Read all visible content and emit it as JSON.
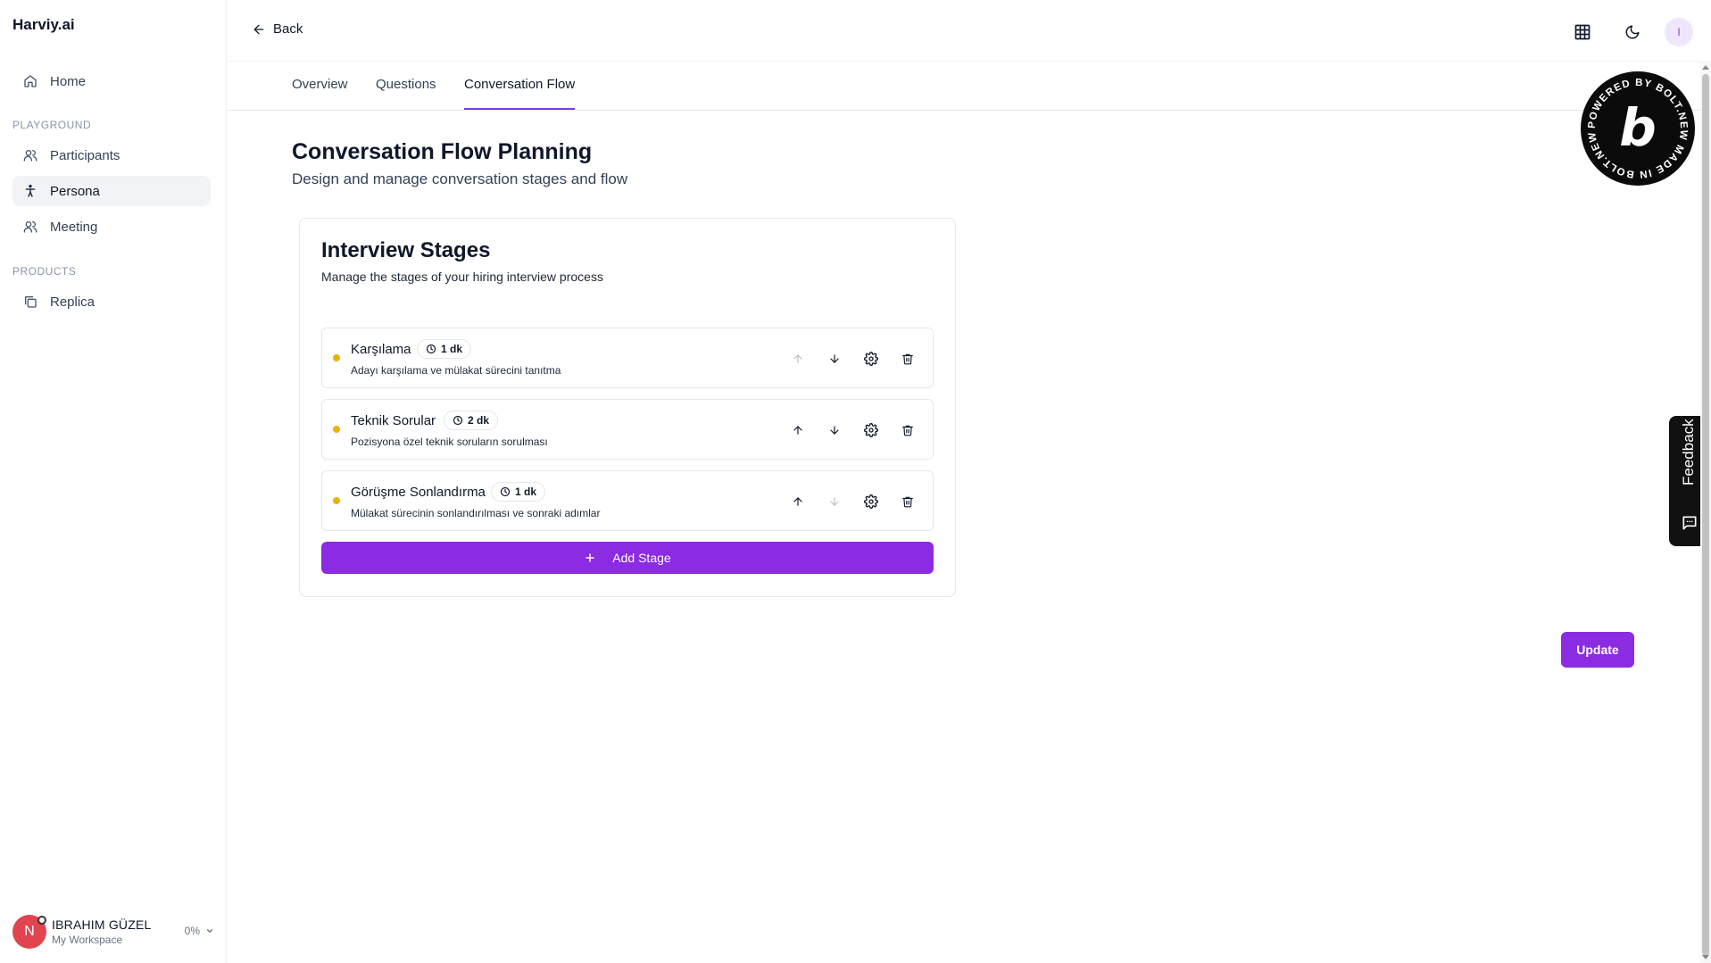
{
  "brand": "Harviy.ai",
  "sidebar": {
    "home": "Home",
    "playground_label": "PLAYGROUND",
    "participants": "Participants",
    "persona": "Persona",
    "meeting": "Meeting",
    "products_label": "PRODUCTS",
    "replica": "Replica"
  },
  "user": {
    "initial": "N",
    "name": "IBRAHIM GÜZEL",
    "workspace": "My Workspace",
    "usage": "0%"
  },
  "header": {
    "back": "Back",
    "avatar_initial": "I"
  },
  "tabs": [
    {
      "label": "Overview"
    },
    {
      "label": "Questions"
    },
    {
      "label": "Conversation Flow",
      "active": true
    }
  ],
  "page": {
    "title": "Conversation Flow Planning",
    "subtitle": "Design and manage conversation stages and flow"
  },
  "card": {
    "title": "Interview Stages",
    "subtitle": "Manage the stages of your hiring interview process",
    "add_label": "Add Stage"
  },
  "stages": [
    {
      "name": "Karşılama",
      "duration": "1 dk",
      "description": "Adayı karşılama ve mülakat sürecini tanıtma"
    },
    {
      "name": "Teknik Sorular",
      "duration": "2 dk",
      "description": "Pozisyona özel teknik soruların sorulması"
    },
    {
      "name": "Görüşme Sonlandırma",
      "duration": "1 dk",
      "description": "Mülakat sürecinin sonlandırılması ve sonraki adımlar"
    }
  ],
  "update_label": "Update",
  "feedback_label": "Feedback",
  "bolt_badge": {
    "letter": "b",
    "ring_text": "POWERED BY BOLT.NEW MADE IN BOLT.NEW"
  },
  "colors": {
    "accent": "#8b2be2",
    "stage_dot": "#eab308",
    "avatar": "#e0444f"
  }
}
